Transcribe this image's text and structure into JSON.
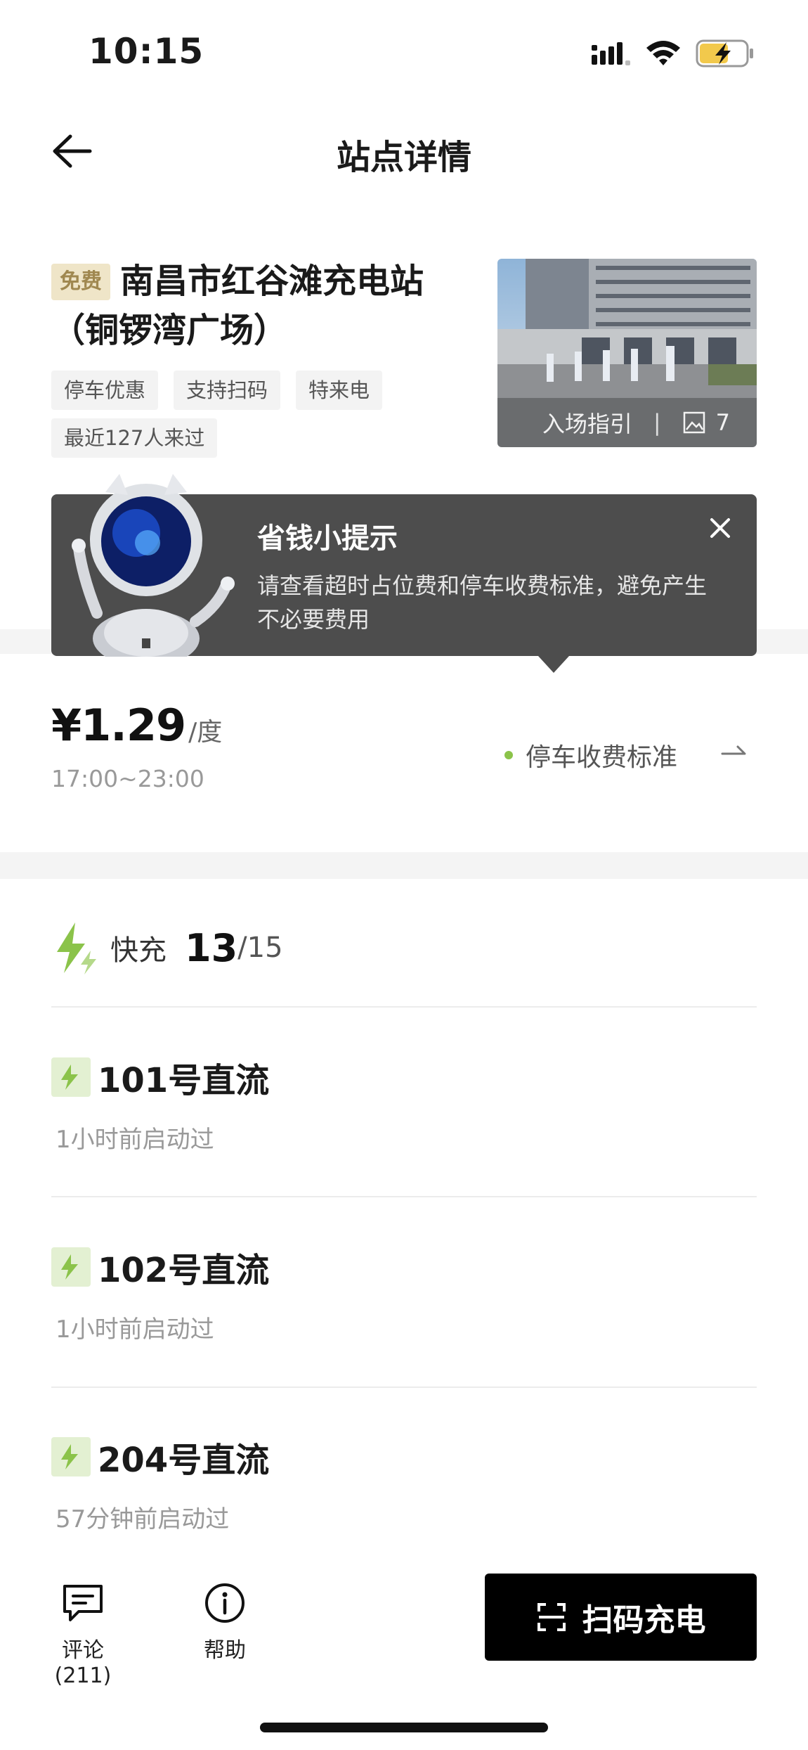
{
  "status_bar": {
    "time": "10:15"
  },
  "nav": {
    "title": "站点详情"
  },
  "station": {
    "badge": "免费",
    "name": "南昌市红谷滩充电站（铜锣湾广场）",
    "tags": [
      "停车优惠",
      "支持扫码",
      "特来电",
      "最近127人来过"
    ],
    "photo": {
      "caption": "入场指引",
      "separator": "|",
      "count": "7"
    }
  },
  "tip": {
    "title": "省钱小提示",
    "text": "请查看超时占位费和停车收费标准，避免产生不必要费用"
  },
  "price": {
    "value": "¥1.29",
    "unit": "/度",
    "time": "17:00~23:00",
    "parking_link": "停车收费标准"
  },
  "fast_charge": {
    "label": "快充",
    "available": "13",
    "total": "/15",
    "accent_color": "#8bc34a"
  },
  "chargers": [
    {
      "name": "101号直流",
      "status": "1小时前启动过"
    },
    {
      "name": "102号直流",
      "status": "1小时前启动过"
    },
    {
      "name": "204号直流",
      "status": "57分钟前启动过"
    }
  ],
  "bottom_bar": {
    "comments_label": "评论(211)",
    "help_label": "帮助",
    "scan_label": "扫码充电"
  }
}
